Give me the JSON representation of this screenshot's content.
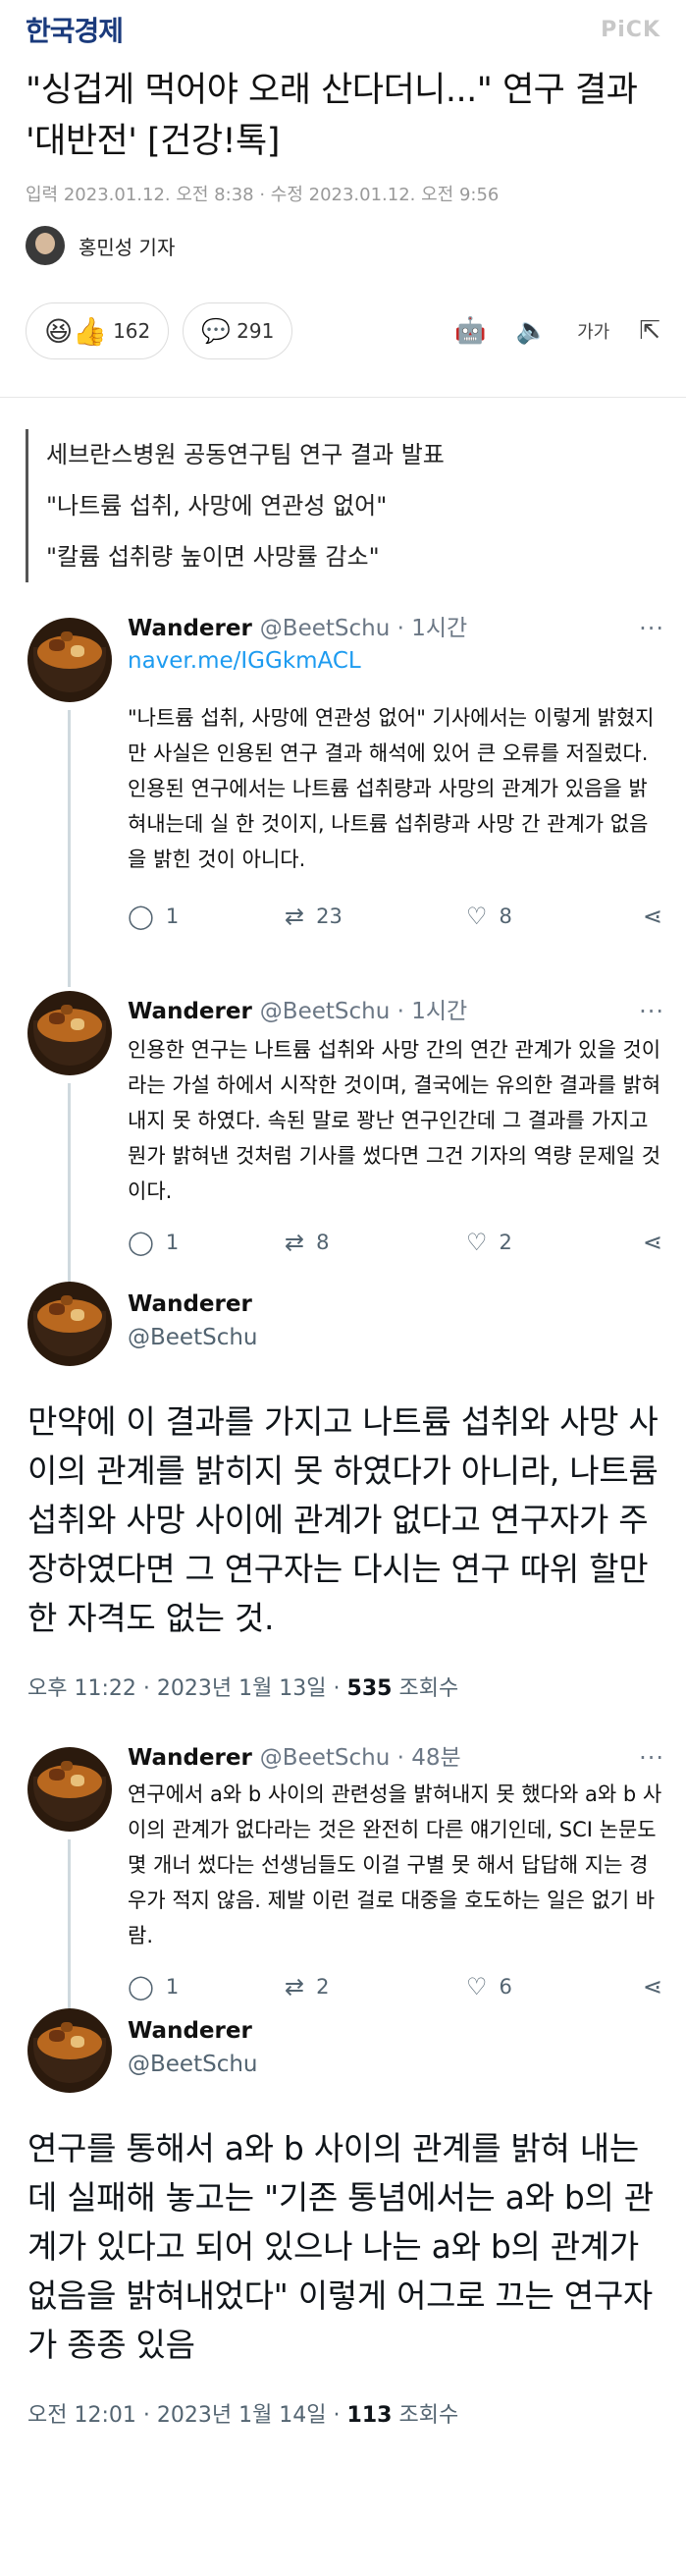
{
  "article": {
    "brand": "한국경제",
    "pick": "PiCK",
    "headline": "\"싱겁게 먹어야 오래 산다더니...\" 연구 결과 '대반전' [건강!톡]",
    "dates": "입력 2023.01.12. 오전 8:38 · 수정 2023.01.12. 오전 9:56",
    "author": "홍민성 기자",
    "reactions": {
      "emoji": "😆👍",
      "count": "162"
    },
    "comments": {
      "count": "291"
    },
    "tools": [
      "robot-icon",
      "speaker-icon",
      "font-size-icon",
      "share-icon"
    ],
    "font_label": "가가",
    "summary": [
      "세브란스병원 공동연구팀 연구 결과 발표",
      "\"나트륨 섭취, 사망에 연관성 없어\"",
      "\"칼륨 섭취량 높이면 사망률 감소\""
    ]
  },
  "tweets": [
    {
      "name": "Wanderer",
      "handle": "@BeetSchu · 1시간",
      "link": "naver.me/IGGkmACL",
      "body": "\"나트륨 섭취, 사망에 연관성 없어\" 기사에서는 이렇게 밝혔지만 사실은 인용된 연구 결과 해석에 있어 큰 오류를 저질렀다. 인용된 연구에서는 나트륨 섭취량과 사망의 관계가 있음을 밝혀내는데 실 한 것이지, 나트륨 섭취량과 사망 간 관계가 없음을 밝힌 것이 아니다.",
      "replies": "1",
      "retweets": "23",
      "likes": "8"
    },
    {
      "name": "Wanderer",
      "handle": "@BeetSchu · 1시간",
      "body": "인용한 연구는 나트륨 섭취와 사망 간의 연간 관계가 있을 것이라는 가설 하에서 시작한 것이며, 결국에는 유의한 결과를 밝혀내지 못 하였다. 속된 말로 꽝난 연구인간데 그 결과를 가지고 뭔가 밝혀낸 것처럼 기사를 썼다면 그건 기자의 역량 문제일 것이다.",
      "replies": "1",
      "retweets": "8",
      "likes": "2"
    }
  ],
  "big1": {
    "name": "Wanderer",
    "handle": "@BeetSchu",
    "text": "만약에 이 결과를 가지고 나트륨 섭취와 사망 사이의 관계를 밝히지 못 하였다가 아니라, 나트륨 섭취와 사망 사이에 관계가 없다고 연구자가 주장하였다면 그 연구자는 다시는 연구 따위 할만한 자격도 없는 것.",
    "time": "오후 11:22 · 2023년 1월 13일 · ",
    "views": "535",
    "views_label": " 조회수"
  },
  "tweet3": {
    "name": "Wanderer",
    "handle": "@BeetSchu · 48분",
    "body": "연구에서 a와 b 사이의 관련성을 밝혀내지 못 했다와 a와 b 사이의 관계가 없다라는 것은 완전히 다른 얘기인데, SCI 논문도 몇 개너 썼다는 선생님들도 이걸 구별 못 해서 답답해 지는 경우가 적지 않음. 제발 이런 걸로 대중을 호도하는 일은 없기 바람.",
    "replies": "1",
    "retweets": "2",
    "likes": "6"
  },
  "big2": {
    "name": "Wanderer",
    "handle": "@BeetSchu",
    "text": "연구를 통해서 a와 b 사이의 관계를 밝혀 내는데 실패해 놓고는 \"기존 통념에서는 a와 b의 관계가 있다고 되어 있으나 나는 a와 b의 관계가 없음을 밝혀내었다\" 이렇게 어그로 끄는 연구자가 종종 있음",
    "time": "오전 12:01 · 2023년 1월 14일 · ",
    "views": "113",
    "views_label": " 조회수"
  },
  "icons": {
    "more": "···",
    "reply": "◯",
    "retweet": "⇄",
    "like": "♡",
    "share": "⋖"
  }
}
